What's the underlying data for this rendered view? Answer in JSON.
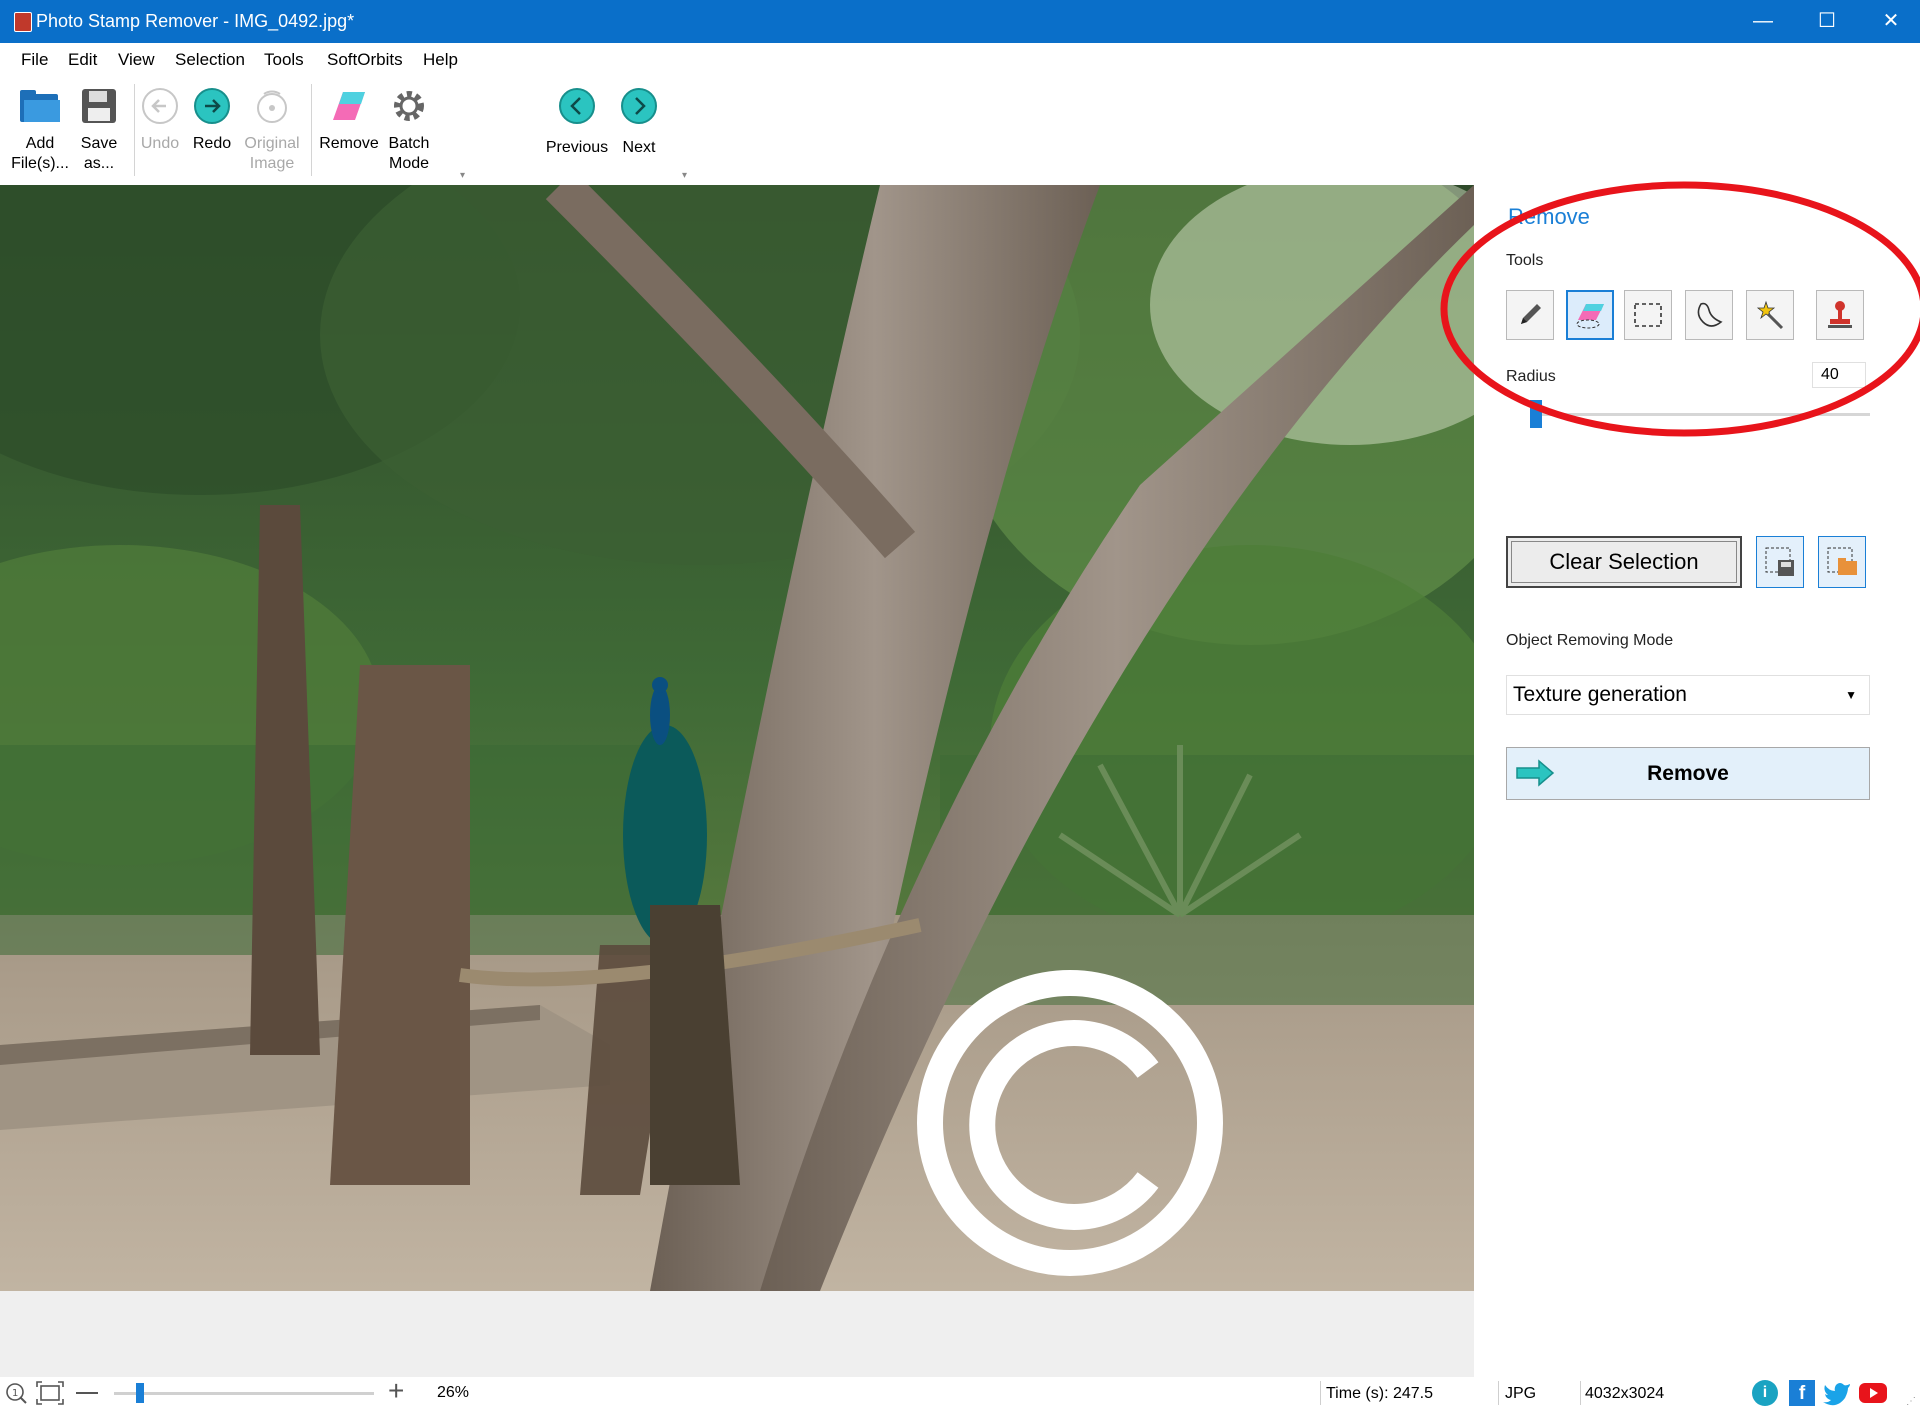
{
  "window": {
    "title": "Photo Stamp Remover - IMG_0492.jpg*",
    "minimize": "—",
    "maximize": "☐",
    "close": "✕"
  },
  "menu": [
    "File",
    "Edit",
    "View",
    "Selection",
    "Tools",
    "SoftOrbits",
    "Help"
  ],
  "toolbar": {
    "add": "Add File(s)...",
    "save": "Save as...",
    "undo": "Undo",
    "redo": "Redo",
    "original": "Original Image",
    "remove": "Remove",
    "batch": "Batch Mode",
    "previous": "Previous",
    "next": "Next"
  },
  "panel": {
    "heading": "Remove",
    "tools_label": "Tools",
    "tools": [
      "pencil-icon",
      "eraser-icon",
      "rect-select-icon",
      "lasso-icon",
      "magic-wand-icon",
      "stamp-icon"
    ],
    "active_tool": "eraser-icon",
    "radius_label": "Radius",
    "radius_value": "40",
    "clear_selection": "Clear Selection",
    "mode_label": "Object Removing Mode",
    "mode_value": "Texture generation",
    "remove_button": "Remove"
  },
  "status": {
    "zoom": "26%",
    "time": "Time (s): 247.5",
    "format": "JPG",
    "dimensions": "4032x3024"
  },
  "colors": {
    "titlebar": "#0a6fc9",
    "accent": "#1a7fd6",
    "highlight_ellipse": "#e8141b"
  }
}
